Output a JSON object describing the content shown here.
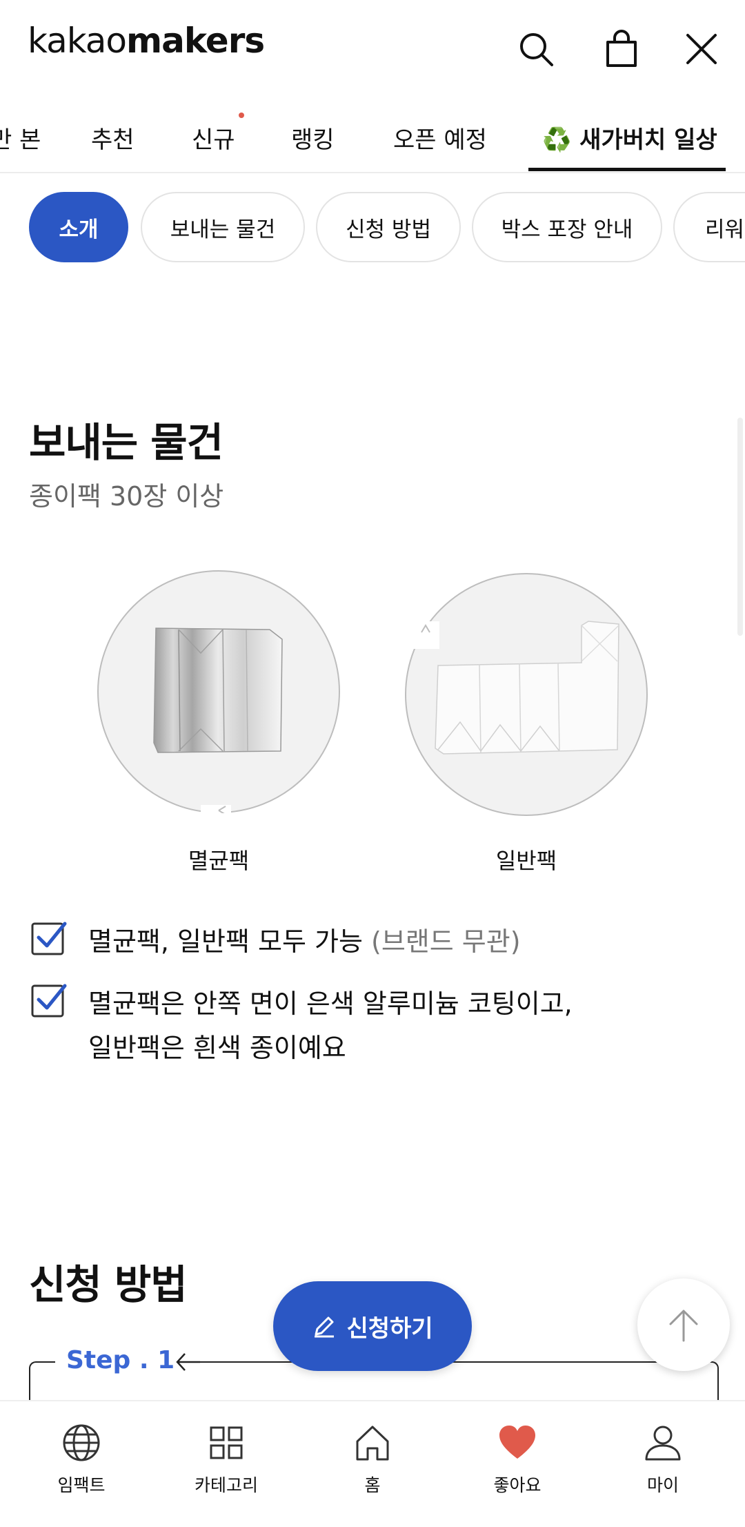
{
  "header": {
    "logo_part1": "kakao",
    "logo_part2": "makers"
  },
  "tabs": [
    {
      "label": "만 본"
    },
    {
      "label": "추천"
    },
    {
      "label": "신규"
    },
    {
      "label": "랭킹"
    },
    {
      "label": "오픈 예정"
    },
    {
      "label": "♻️ 새가버치 일상"
    }
  ],
  "chips": [
    {
      "label": "소개"
    },
    {
      "label": "보내는 물건"
    },
    {
      "label": "신청 방법"
    },
    {
      "label": "박스 포장 안내"
    },
    {
      "label": "리워"
    }
  ],
  "section": {
    "title": "보내는 물건",
    "subtitle": "종이팩 30장 이상",
    "packs": [
      {
        "label": "멸균팩"
      },
      {
        "label": "일반팩"
      }
    ],
    "checks": [
      {
        "text": "멸균팩, 일반팩 모두 가능",
        "note": "(브랜드 무관)"
      },
      {
        "line1": "멸균팩은 안쪽 면이 은색 알루미늄 코팅이고,",
        "line2": "일반팩은 흰색 종이예요"
      }
    ]
  },
  "apply_section": {
    "title": "신청 방법",
    "step_label": "Step . 1"
  },
  "floating": {
    "apply_button": "신청하기"
  },
  "bottom_nav": [
    {
      "label": "임팩트",
      "icon": "globe-icon"
    },
    {
      "label": "카테고리",
      "icon": "grid-icon"
    },
    {
      "label": "홈",
      "icon": "home-icon"
    },
    {
      "label": "좋아요",
      "icon": "heart-icon"
    },
    {
      "label": "마이",
      "icon": "user-icon"
    }
  ],
  "colors": {
    "brand_blue": "#2b57c4",
    "heart_red": "#e05a4b",
    "step_blue": "#3b67d4"
  }
}
